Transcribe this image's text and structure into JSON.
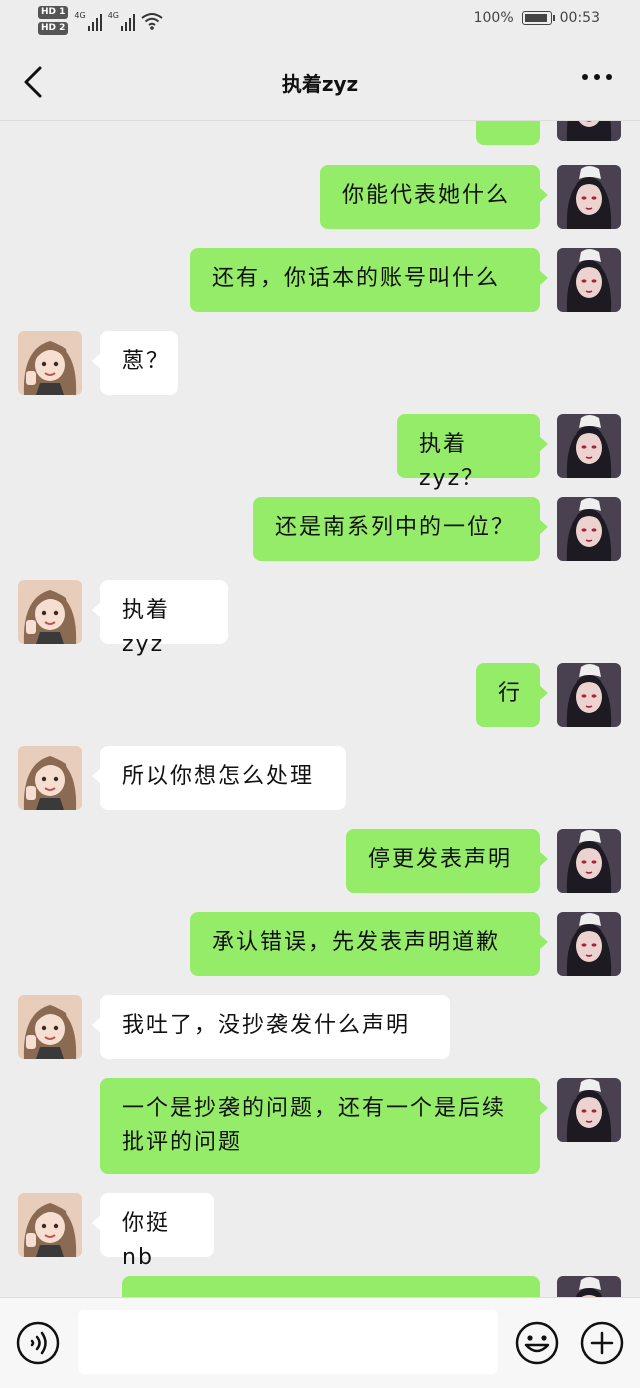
{
  "status_bar": {
    "sim1": "HD 1",
    "sim2": "HD 2",
    "network1": "4G",
    "network2": "4G",
    "battery": "100%",
    "time": "00:53"
  },
  "header": {
    "title": "执着zyz",
    "back_icon": "chevron-left-icon",
    "more_icon": "more-icon"
  },
  "messages": [
    {
      "side": "me",
      "text": "",
      "partial": true
    },
    {
      "side": "me",
      "text": "你能代表她什么"
    },
    {
      "side": "me",
      "text": "还有，你话本的账号叫什么"
    },
    {
      "side": "them",
      "text": "蒽？"
    },
    {
      "side": "me",
      "text": "执着zyz？"
    },
    {
      "side": "me",
      "text": "还是南系列中的一位？"
    },
    {
      "side": "them",
      "text": "执着zyz"
    },
    {
      "side": "me",
      "text": "行"
    },
    {
      "side": "them",
      "text": "所以你想怎么处理"
    },
    {
      "side": "me",
      "text": "停更发表声明"
    },
    {
      "side": "me",
      "text": "承认错误，先发表声明道歉"
    },
    {
      "side": "them",
      "text": "我吐了，没抄袭发什么声明"
    },
    {
      "side": "me",
      "text": "一个是抄袭的问题，还有一个是后续批评的问题"
    },
    {
      "side": "them",
      "text": "你挺nb"
    },
    {
      "side": "me",
      "text": "",
      "partial": true
    }
  ],
  "input_bar": {
    "voice_icon": "voice-icon",
    "emoji_icon": "emoji-icon",
    "plus_icon": "plus-icon",
    "placeholder": ""
  },
  "colors": {
    "background": "#ededed",
    "my_bubble": "#95ec69",
    "their_bubble": "#ffffff"
  }
}
